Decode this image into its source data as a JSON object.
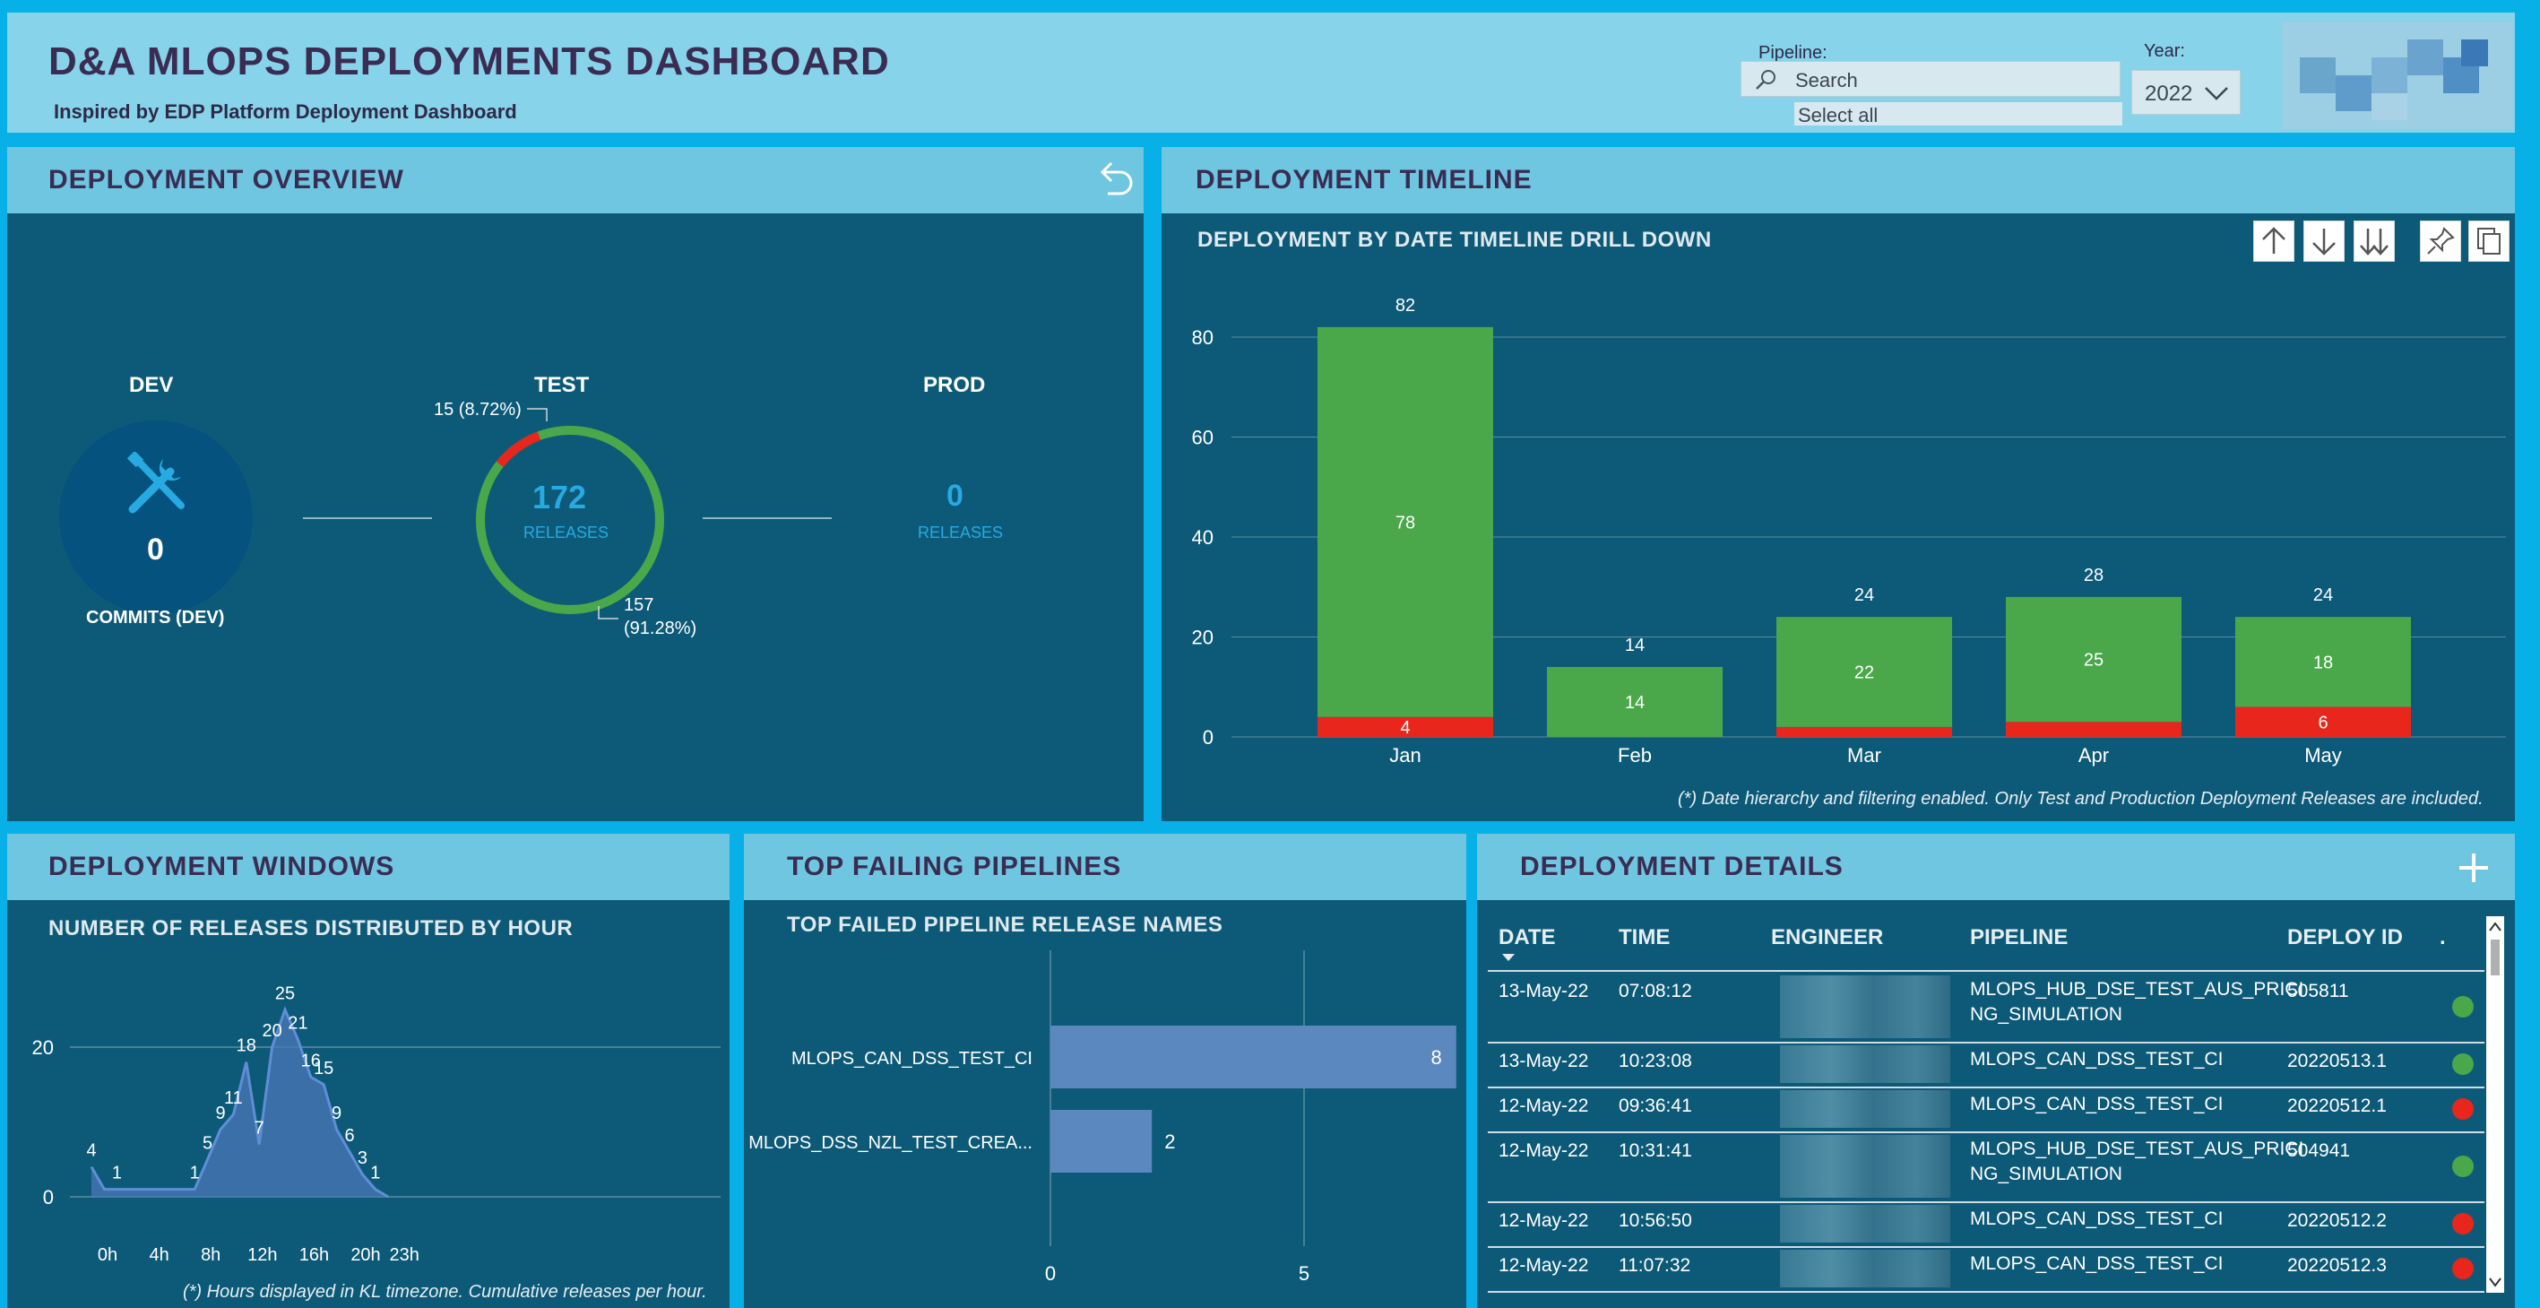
{
  "header": {
    "title": "D&A MLOPS DEPLOYMENTS DASHBOARD",
    "subtitle": "Inspired by EDP Platform Deployment Dashboard",
    "pipeline_label": "Pipeline:",
    "search_placeholder": "Search",
    "select_all": "Select all",
    "year_label": "Year:",
    "year_value": "2022"
  },
  "overview": {
    "title": "DEPLOYMENT OVERVIEW",
    "dev_label": "DEV",
    "dev_value": "0",
    "dev_caption": "COMMITS (DEV)",
    "test_label": "TEST",
    "test_value": "172",
    "test_caption": "RELEASES",
    "prod_label": "PROD",
    "prod_value": "0",
    "prod_caption": "RELEASES",
    "failed_label": "15 (8.72%)",
    "success_label_1": "157",
    "success_label_2": "(91.28%)",
    "failed_fraction": 0.0872
  },
  "timeline": {
    "title": "DEPLOYMENT TIMELINE",
    "chart_title": "DEPLOYMENT BY DATE TIMELINE DRILL DOWN",
    "footnote": "(*)  Date hierarchy and filtering enabled. Only Test and Production Deployment Releases are included."
  },
  "windows": {
    "title": "DEPLOYMENT WINDOWS",
    "chart_title": "NUMBER OF RELEASES DISTRIBUTED BY HOUR",
    "footnote": "(*) Hours displayed in KL timezone. Cumulative releases per hour."
  },
  "failing": {
    "title": "TOP FAILING PIPELINES",
    "chart_title": "TOP FAILED PIPELINE RELEASE NAMES"
  },
  "details": {
    "title": "DEPLOYMENT DETAILS",
    "columns": [
      "DATE",
      "TIME",
      "ENGINEER",
      "PIPELINE",
      "DEPLOY ID",
      "."
    ],
    "rows": [
      {
        "date": "13-May-22",
        "time": "07:08:12",
        "pipeline": "MLOPS_HUB_DSE_TEST_AUS_PRICI NG_SIMULATION",
        "deploy_id": "505811",
        "status": "success"
      },
      {
        "date": "13-May-22",
        "time": "10:23:08",
        "pipeline": "MLOPS_CAN_DSS_TEST_CI",
        "deploy_id": "20220513.1",
        "status": "success"
      },
      {
        "date": "12-May-22",
        "time": "09:36:41",
        "pipeline": "MLOPS_CAN_DSS_TEST_CI",
        "deploy_id": "20220512.1",
        "status": "failed"
      },
      {
        "date": "12-May-22",
        "time": "10:31:41",
        "pipeline": "MLOPS_HUB_DSE_TEST_AUS_PRICI NG_SIMULATION",
        "deploy_id": "504941",
        "status": "success"
      },
      {
        "date": "12-May-22",
        "time": "10:56:50",
        "pipeline": "MLOPS_CAN_DSS_TEST_CI",
        "deploy_id": "20220512.2",
        "status": "failed"
      },
      {
        "date": "12-May-22",
        "time": "11:07:32",
        "pipeline": "MLOPS_CAN_DSS_TEST_CI",
        "deploy_id": "20220512.3",
        "status": "failed"
      }
    ]
  },
  "colors": {
    "success": "#4aa84a",
    "failed": "#e8261c",
    "accent": "#27a9e1",
    "title_text": "#3a2c52"
  },
  "chart_data": [
    {
      "type": "bar",
      "stacked": true,
      "categories": [
        "Jan",
        "Feb",
        "Mar",
        "Apr",
        "May"
      ],
      "series": [
        {
          "values": [
            4,
            0,
            2,
            3,
            6
          ],
          "color": "#e8261c"
        },
        {
          "values": [
            78,
            14,
            22,
            25,
            18
          ],
          "color": "#4aa84a"
        }
      ],
      "totals": [
        82,
        14,
        24,
        28,
        24
      ],
      "segment_labels_red": [
        "4",
        "",
        "",
        "",
        "6"
      ],
      "ylim": [
        0,
        85
      ],
      "yticks": [
        0,
        20,
        40,
        60,
        80
      ],
      "grid": true
    },
    {
      "type": "area",
      "x": [
        0,
        1,
        2,
        3,
        4,
        5,
        6,
        7,
        8,
        9,
        10,
        11,
        12,
        13,
        14,
        15,
        16,
        17,
        18,
        19,
        20,
        21,
        22,
        23
      ],
      "values": [
        4,
        1,
        1,
        1,
        1,
        1,
        1,
        1,
        1,
        5,
        9,
        11,
        18,
        7,
        20,
        25,
        21,
        16,
        15,
        9,
        6,
        3,
        1,
        0
      ],
      "labels": [
        "4",
        "1",
        "",
        "",
        "",
        "",
        "",
        "",
        "1",
        "5",
        "9",
        "11",
        "18",
        "7",
        "20",
        "25",
        "21",
        "16",
        "15",
        "9",
        "6",
        "3",
        "1",
        ""
      ],
      "xtick_labels": [
        "0h",
        "4h",
        "8h",
        "12h",
        "16h",
        "20h",
        "23h"
      ],
      "xtick_positions": [
        0,
        4,
        8,
        12,
        16,
        20,
        23
      ],
      "yticks": [
        0,
        20
      ],
      "ylim": [
        0,
        27
      ]
    },
    {
      "type": "bar",
      "orientation": "horizontal",
      "categories": [
        "MLOPS_CAN_DSS_TEST_CI",
        "MLOPS_DSS_NZL_TEST_CREA..."
      ],
      "values": [
        8,
        2
      ],
      "xticks": [
        0,
        5
      ],
      "xlim": [
        0,
        8.5
      ]
    }
  ]
}
